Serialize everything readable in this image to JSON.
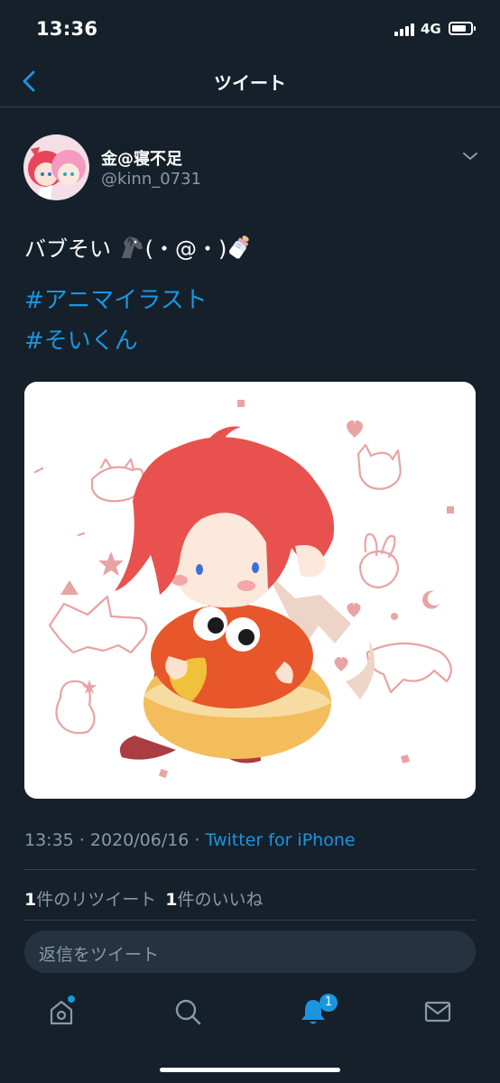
{
  "status_bar": {
    "time": "13:36",
    "network": "4G"
  },
  "nav": {
    "title": "ツイート"
  },
  "tweet": {
    "display_name": "金@寝不足",
    "handle": "@kinn_0731",
    "text_prefix": "バブそい ",
    "text_middle": "(・@・)",
    "hashtags": [
      "#アニマイラスト",
      "#そいくん"
    ],
    "time": "13:35",
    "separator": " · ",
    "date": "2020/06/16",
    "source": "Twitter for iPhone",
    "retweets_count": "1",
    "retweets_label": "件のリツイート",
    "likes_count": "1",
    "likes_label": "件のいいね"
  },
  "reply": {
    "placeholder": "返信をツイート"
  },
  "tabbar": {
    "notifications_badge": "1"
  },
  "colors": {
    "background": "#15202b",
    "accent": "#1b95e0",
    "secondary_text": "#8899a6",
    "divider": "#38444d"
  }
}
